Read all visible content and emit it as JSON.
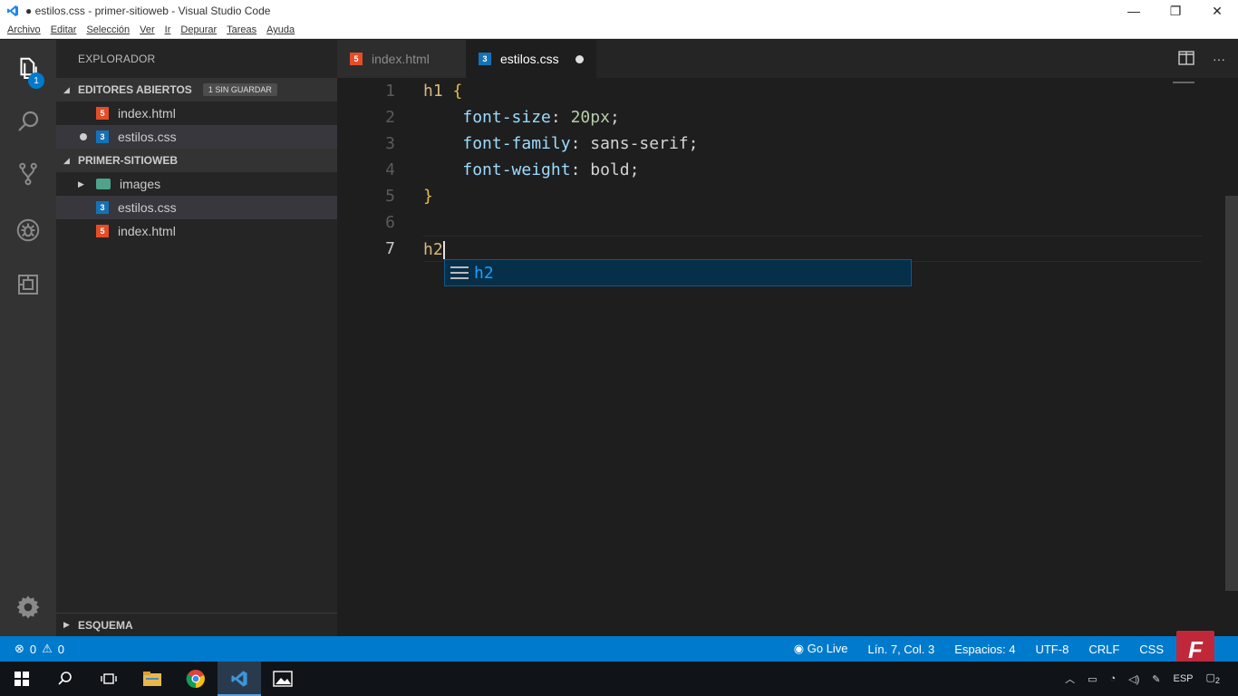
{
  "window": {
    "title": "● estilos.css - primer-sitioweb - Visual Studio Code",
    "controls": [
      "—",
      "❐",
      "✕"
    ]
  },
  "menu": [
    "Archivo",
    "Editar",
    "Selección",
    "Ver",
    "Ir",
    "Depurar",
    "Tareas",
    "Ayuda"
  ],
  "activity": {
    "explorer_badge": "1",
    "icons": [
      "explorer-icon",
      "search-icon",
      "source-control-icon",
      "debug-icon",
      "extensions-icon",
      "settings-icon"
    ]
  },
  "sidebar": {
    "title": "EXPLORADOR",
    "open_editors": {
      "label": "EDITORES ABIERTOS",
      "unsaved": "1 SIN GUARDAR",
      "items": [
        "index.html",
        "estilos.css"
      ]
    },
    "project": {
      "label": "PRIMER-SITIOWEB",
      "items": [
        "images",
        "estilos.css",
        "index.html"
      ]
    },
    "outline": "ESQUEMA"
  },
  "tabs": [
    {
      "label": "index.html"
    },
    {
      "label": "estilos.css"
    }
  ],
  "editor": {
    "line_numbers": [
      "1",
      "2",
      "3",
      "4",
      "5",
      "6",
      "7"
    ],
    "line1_selector": "h1",
    "line1_brace": " {",
    "line2_prop": "font-size",
    "line2_rest": ": ",
    "line2_num": "20px",
    "line2_end": ";",
    "line3_prop": "font-family",
    "line3_rest": ": sans-serif;",
    "line4_prop": "font-weight",
    "line4_rest": ": bold;",
    "line5_brace": "}",
    "line7_text": "h2",
    "suggestion": "h2"
  },
  "status": {
    "errors": "0",
    "warnings": "0",
    "go_live": "Go Live",
    "position": "Lín. 7, Col. 3",
    "spaces": "Espacios: 4",
    "encoding": "UTF-8",
    "eol": "CRLF",
    "language": "CSS"
  },
  "taskbar": {
    "tray_lang": "ESP",
    "notification_count": "2"
  },
  "watermark": "F"
}
